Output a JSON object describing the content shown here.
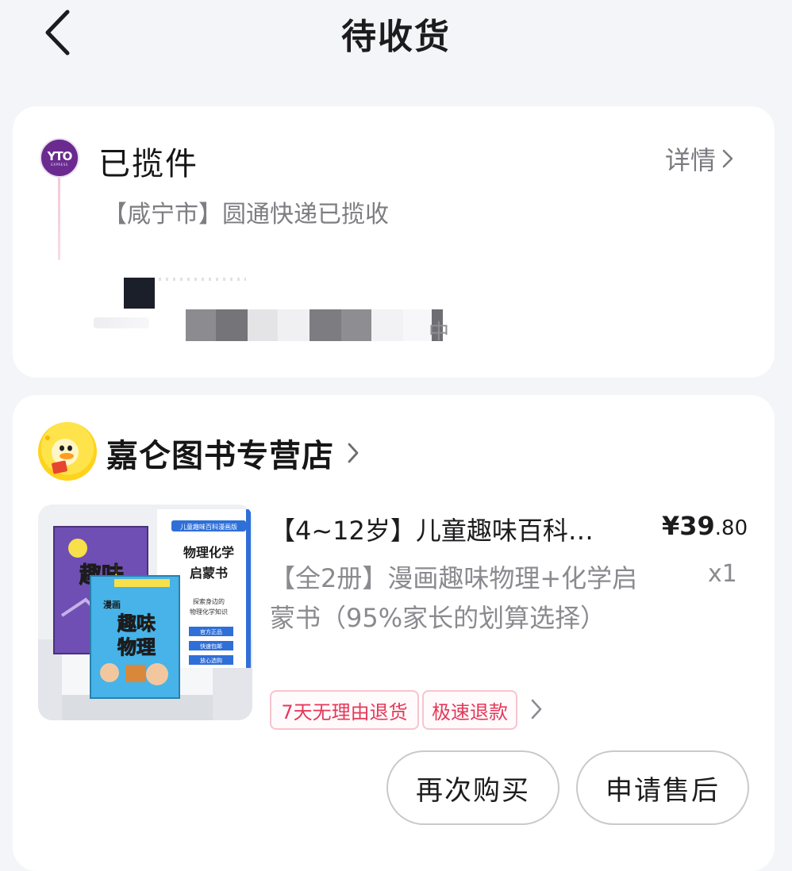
{
  "header": {
    "title": "待收货",
    "back_icon": "chevron-left-icon"
  },
  "logistics": {
    "courier_logo_text": "YTO",
    "courier_logo_subtext": "EXPRESS",
    "status": "已揽件",
    "detail_label": "详情",
    "description": "【咸宁市】圆通快递已揽收",
    "partial_text": "中"
  },
  "store": {
    "name": "嘉仑图书专营店"
  },
  "product": {
    "title": "【4~12岁】儿童趣味百科…",
    "price_main": "¥39",
    "price_cents": ".80",
    "spec": "【全2册】漫画趣味物理+化学启蒙书（95%家长的划算选择）",
    "quantity": "x1",
    "cover": {
      "top_banner": "儿童趣味百科漫画版",
      "title_line1": "物理化学",
      "title_line2": "启蒙书",
      "subtitle_line1": "探索身边的",
      "subtitle_line2": "物理化学知识",
      "badges": [
        "官方正品",
        "快速包邮",
        "放心选购"
      ],
      "book_word1": "趣味",
      "book_word2": "物理",
      "book_tag": "漫画"
    }
  },
  "tags": [
    "7天无理由退货",
    "极速退款"
  ],
  "actions": {
    "rebuy": "再次购买",
    "aftersale": "申请售后"
  },
  "colors": {
    "background": "#f4f5f9",
    "card": "#ffffff",
    "tag_text": "#e4395a",
    "tag_border": "#f6c4cf",
    "courier_purple": "#6a2a8f",
    "muted_text": "#8a8a8f"
  }
}
